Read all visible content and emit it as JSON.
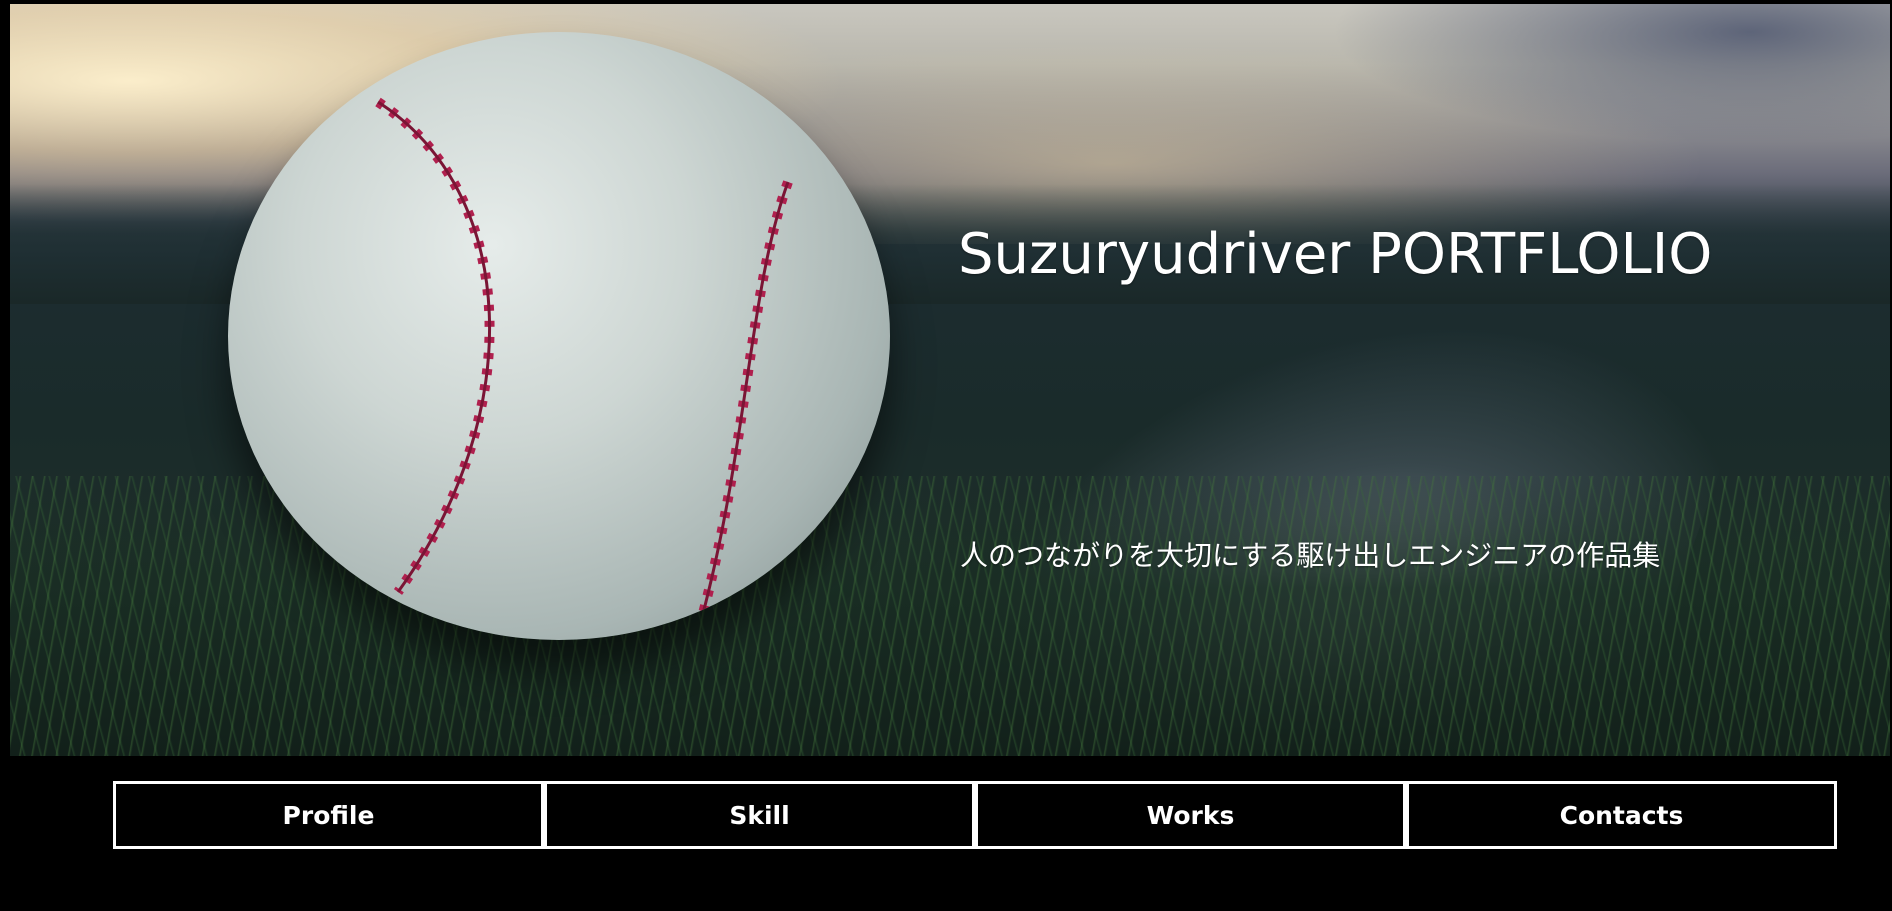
{
  "hero": {
    "title": "Suzuryudriver PORTFLOLIO",
    "subtitle": "人のつながりを大切にする駆け出しエンジニアの作品集",
    "image": "baseball-on-grass-photo"
  },
  "nav": {
    "items": [
      {
        "label": "Profile"
      },
      {
        "label": "Skill"
      },
      {
        "label": "Works"
      },
      {
        "label": "Contacts"
      }
    ]
  },
  "colors": {
    "background": "#000000",
    "text": "#ffffff",
    "nav_border": "#ffffff",
    "stitch": "#b0204e"
  }
}
